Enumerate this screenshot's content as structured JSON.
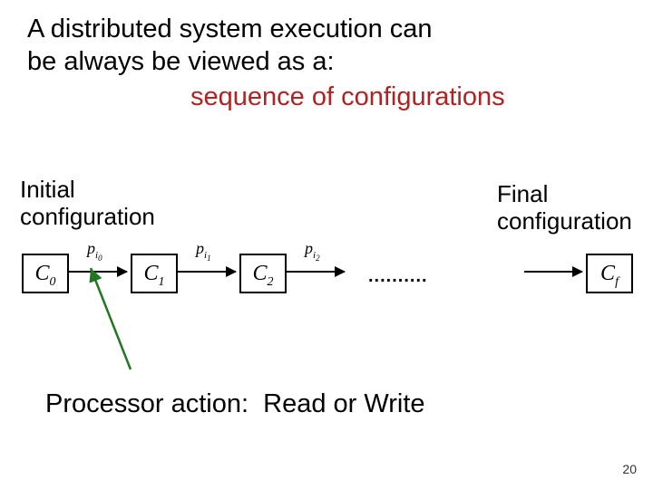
{
  "title": {
    "line1": "A distributed system execution can",
    "line2": "be always be viewed as a:",
    "emphasis": "sequence of configurations"
  },
  "labels": {
    "initial_l1": "Initial",
    "initial_l2": "configuration",
    "final_l1": "Final",
    "final_l2": "configuration"
  },
  "nodes": {
    "c0": "C",
    "c0_sub": "0",
    "c1": "C",
    "c1_sub": "1",
    "c2": "C",
    "c2_sub": "2",
    "cf": "C",
    "cf_sub": "f"
  },
  "transitions": {
    "p0_base": "p",
    "p0_sub": "i",
    "p0_subsub": "0",
    "p1_base": "p",
    "p1_sub": "i",
    "p1_subsub": "1",
    "p2_base": "p",
    "p2_sub": "i",
    "p2_subsub": "2"
  },
  "ellipsis": "..........",
  "processor": {
    "label": "Processor action:",
    "value": "Read or Write"
  },
  "page_number": "20",
  "colors": {
    "emphasis": "#b22222",
    "arrow_callout": "#227722"
  }
}
